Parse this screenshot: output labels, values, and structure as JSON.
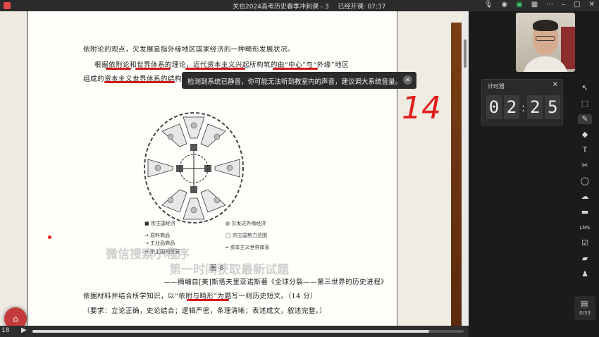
{
  "titlebar": {
    "title": "关也2024高考历史春季冲刺课 - 3",
    "started": "已经开课: 07:37",
    "icons": [
      "mic-icon",
      "speaker-icon",
      "share-icon",
      "layout-icon",
      "more-icon",
      "minimize-icon",
      "maximize-icon",
      "close-icon"
    ]
  },
  "document": {
    "lines": [
      "依附论的观点，欠发展是指外缘地区国家经济的一种畸形发展状况。",
      "根据依附论和世界体系的理论，近代资本主义兴起所构筑的由“中心”与“外缘”地区",
      "组成的资本主义世界体系的结构，"
    ],
    "legend": {
      "core": "宗主国经济",
      "periphery": "欠发达外缘经济",
      "raw": "原料商品",
      "industrial": "工业品商品",
      "trade": "宗主国间贸易",
      "sphere": "宗主国势力范围",
      "system": "资本主义世界体系"
    },
    "figure_label": "图 8",
    "source": "——摘编自[美]斯塔夫里亚诺斯著《全球分裂——第三世界的历史进程》",
    "question": "依据材料并结合所学知识，以“依附与畸形”为题写一则历史短文。（14 分）",
    "requirements": "（要求：立论正确，史论结合；逻辑严密，条理清晰；表述成文，叙述完整。）"
  },
  "toast": {
    "message": "检测到系统已静音，你可能无法听到教室内的声音，建议调大系统音量。"
  },
  "annotations": {
    "handwritten": "14"
  },
  "watermarks": [
    "微信搜索小程序",
    "第一时间获取最新试题"
  ],
  "timer": {
    "title": "计时器",
    "close": "✕",
    "digits": [
      "0",
      "2",
      "2",
      "5"
    ]
  },
  "toolbar": {
    "tools": [
      {
        "name": "pointer-icon",
        "glyph": "↖"
      },
      {
        "name": "select-icon",
        "glyph": "⬚"
      },
      {
        "name": "pen-icon",
        "glyph": "✎"
      },
      {
        "name": "eraser-icon",
        "glyph": "◆"
      },
      {
        "name": "text-icon",
        "glyph": "T"
      },
      {
        "name": "scissors-icon",
        "glyph": "✂"
      },
      {
        "name": "shape-icon",
        "glyph": "◯"
      },
      {
        "name": "cloud-icon",
        "glyph": "☁"
      },
      {
        "name": "box-icon",
        "glyph": "▬"
      },
      {
        "name": "lms-icon",
        "glyph": "LMS"
      },
      {
        "name": "edit-icon",
        "glyph": "☑"
      },
      {
        "name": "chat-icon",
        "glyph": "▰"
      },
      {
        "name": "users-icon",
        "glyph": "♟"
      }
    ]
  },
  "pagecount": {
    "value": "0/33"
  },
  "bottombar": {
    "page": "18",
    "progress": 0.92
  },
  "colors": {
    "accent_red": "#d21818",
    "panel": "#1b1b1b",
    "paper": "#fffefb"
  }
}
